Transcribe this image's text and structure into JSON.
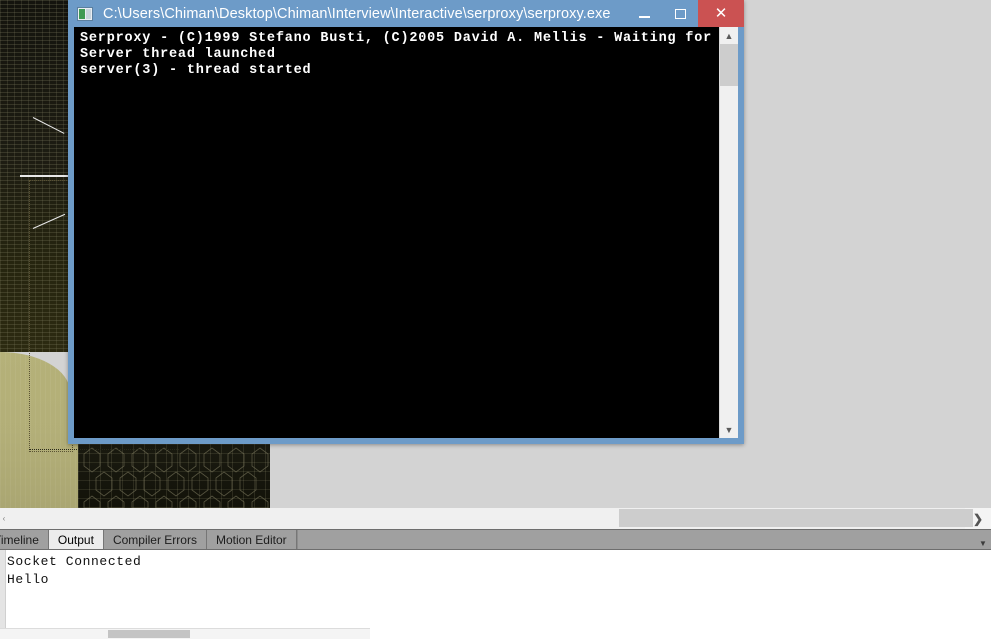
{
  "window": {
    "title": "C:\\Users\\Chiman\\Desktop\\Chiman\\Interview\\Interactive\\serproxy\\serproxy.exe",
    "icon_name": "console-app-icon",
    "controls": {
      "minimize_label": "–",
      "maximize_label": "",
      "close_label": "✕"
    },
    "colors": {
      "titlebar": "#6d9bc8",
      "close_button": "#cb5252",
      "console_background": "#000000",
      "console_text": "#ffffff"
    },
    "console_lines": "Serproxy - (C)1999 Stefano Busti, (C)2005 David A. Mellis - Waiting for clients\nServer thread launched\nserver(3) - thread started",
    "scrollbar": {
      "up_arrow": "▲",
      "down_arrow": "▼"
    }
  },
  "ide": {
    "horizontal_scrollbar": {
      "left_nub": "‹",
      "right_button": "❯"
    },
    "tabs": [
      {
        "label": "Timeline",
        "active": false
      },
      {
        "label": "Output",
        "active": true
      },
      {
        "label": "Compiler Errors",
        "active": false
      },
      {
        "label": "Motion Editor",
        "active": false
      }
    ],
    "tab_overflow_chevron": "▼",
    "output": {
      "lines": "Socket Connected\nHello"
    }
  }
}
